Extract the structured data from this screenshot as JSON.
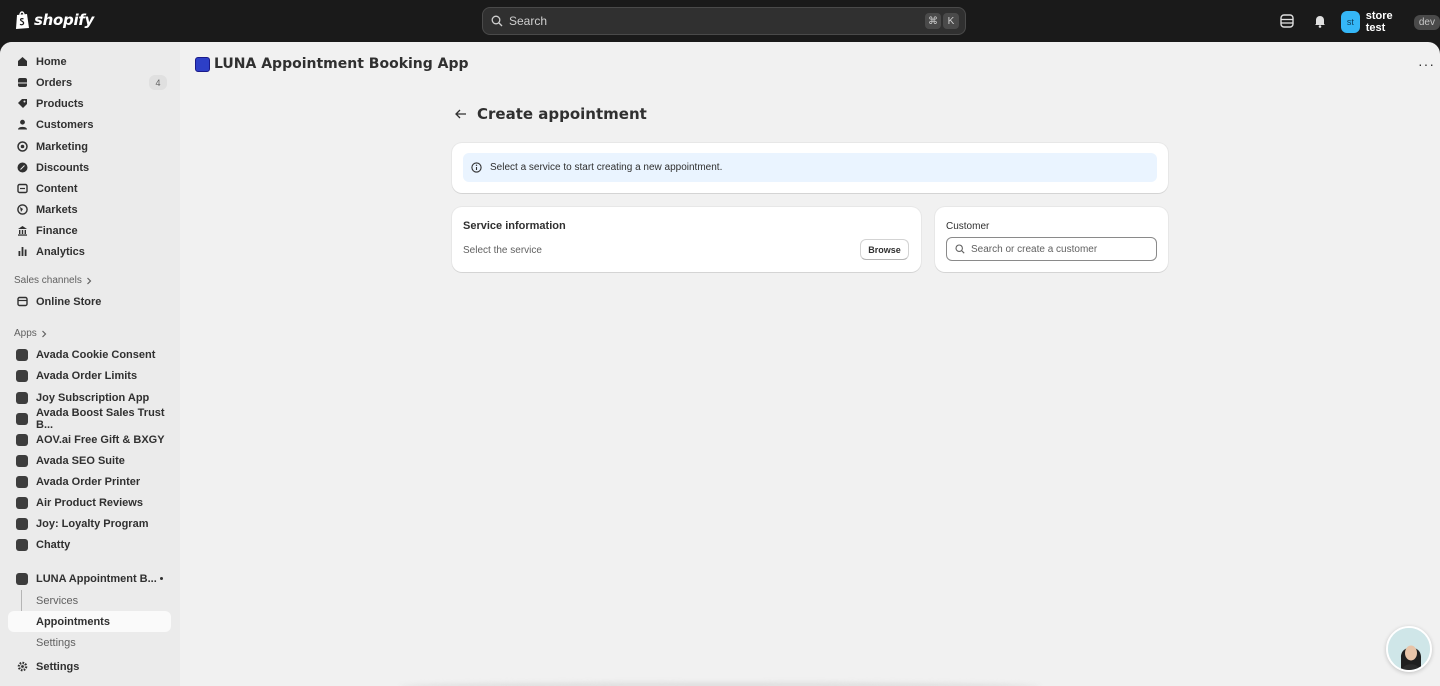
{
  "topbar": {
    "logo_text": "shopify",
    "search_placeholder": "Search",
    "shortcut_keys": [
      "⌘",
      "K"
    ],
    "store_initials": "st",
    "store_name": "store test",
    "store_badge": "dev"
  },
  "sidebar": {
    "main_items": [
      {
        "label": "Home",
        "icon": "home-icon"
      },
      {
        "label": "Orders",
        "icon": "orders-icon",
        "count": "4"
      },
      {
        "label": "Products",
        "icon": "tag-icon"
      },
      {
        "label": "Customers",
        "icon": "person-icon"
      },
      {
        "label": "Marketing",
        "icon": "target-icon"
      },
      {
        "label": "Discounts",
        "icon": "discount-icon"
      },
      {
        "label": "Content",
        "icon": "content-icon"
      },
      {
        "label": "Markets",
        "icon": "globe-icon"
      },
      {
        "label": "Finance",
        "icon": "bank-icon"
      },
      {
        "label": "Analytics",
        "icon": "bar-chart-icon"
      }
    ],
    "sales_channels_label": "Sales channels",
    "sales_channels": [
      {
        "label": "Online Store",
        "icon": "store-icon"
      }
    ],
    "apps_label": "Apps",
    "apps": [
      {
        "label": "Avada Cookie Consent"
      },
      {
        "label": "Avada Order Limits"
      },
      {
        "label": "Joy Subscription App"
      },
      {
        "label": "Avada Boost Sales Trust B..."
      },
      {
        "label": "AOV.ai Free Gift & BXGY"
      },
      {
        "label": "Avada SEO Suite"
      },
      {
        "label": "Avada Order Printer"
      },
      {
        "label": "Air Product Reviews"
      },
      {
        "label": "Joy: Loyalty Program"
      },
      {
        "label": "Chatty"
      }
    ],
    "current_app": {
      "label": "LUNA Appointment B...",
      "sub_items": [
        "Services",
        "Appointments",
        "Settings"
      ],
      "active": "Appointments"
    },
    "settings_label": "Settings"
  },
  "main": {
    "app_title": "LUNA Appointment Booking App",
    "page_title": "Create appointment",
    "banner_text": "Select a service to start creating a new appointment.",
    "service_card": {
      "title": "Service information",
      "subtitle": "Select the service",
      "button": "Browse"
    },
    "customer_card": {
      "label": "Customer",
      "search_placeholder": "Search or create a customer"
    }
  },
  "colors": {
    "topbar": "#1a1a1a",
    "page_bg": "#f1f1f1",
    "sidebar_bg": "#ebebeb",
    "banner_bg": "#eaf4ff",
    "store_avatar": "#35b7f7"
  }
}
